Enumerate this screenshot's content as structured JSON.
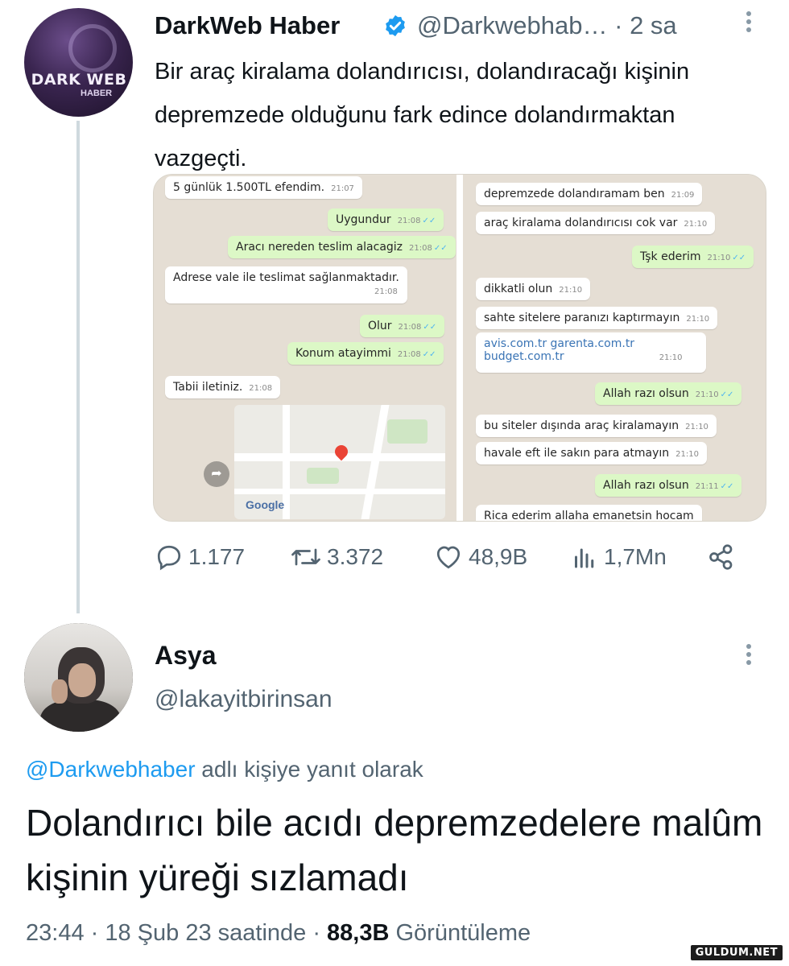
{
  "tweet": {
    "author_name": "DarkWeb Haber",
    "handle": "@Darkwebhab…",
    "time": "· 2 sa",
    "avatar_text": "DARK WEB",
    "avatar_sub": "HABER",
    "text": "Bir araç kiralama dolandırıcısı, dolandıracağı kişinin depremzede olduğunu fark edince dolandırmaktan vazgeçti.",
    "chat_left": [
      {
        "text": "5 günlük 1.500TL efendim.",
        "time": "21:07",
        "dir": "in"
      },
      {
        "text": "Uygundur",
        "time": "21:08",
        "dir": "out"
      },
      {
        "text": "Aracı nereden teslim alacagiz",
        "time": "21:08",
        "dir": "out"
      },
      {
        "text": "Adrese vale ile teslimat sağlanmaktadır.",
        "time": "21:08",
        "dir": "in"
      },
      {
        "text": "Olur",
        "time": "21:08",
        "dir": "out"
      },
      {
        "text": "Konum atayimmi",
        "time": "21:08",
        "dir": "out"
      },
      {
        "text": "Tabii iletiniz.",
        "time": "21:08",
        "dir": "in"
      }
    ],
    "map_label": "Google",
    "chat_right": [
      {
        "text": "depremzede dolandıramam ben",
        "time": "21:09",
        "dir": "in"
      },
      {
        "text": "araç kiralama dolandırıcısı cok var",
        "time": "21:10",
        "dir": "in"
      },
      {
        "text": "Tşk ederim",
        "time": "21:10",
        "dir": "out"
      },
      {
        "text": "dikkatli olun",
        "time": "21:10",
        "dir": "in"
      },
      {
        "text": "sahte sitelere paranızı kaptırmayın",
        "time": "21:10",
        "dir": "in"
      },
      {
        "text": "avis.com.tr garenta.com.tr",
        "text2": "budget.com.tr",
        "time": "21:10",
        "dir": "in"
      },
      {
        "text": "Allah razı olsun",
        "time": "21:10",
        "dir": "out"
      },
      {
        "text": "bu siteler dışında araç kiralamayın",
        "time": "21:10",
        "dir": "in"
      },
      {
        "text": "havale eft ile sakın para atmayın",
        "time": "21:10",
        "dir": "in"
      },
      {
        "text": "Allah razı olsun",
        "time": "21:11",
        "dir": "out"
      },
      {
        "text": "Rica ederim allaha emanetsin hocam",
        "time": "",
        "dir": "in"
      }
    ],
    "stats": {
      "replies": "1.177",
      "retweets": "3.372",
      "likes": "48,9B",
      "views": "1,7Mn"
    }
  },
  "reply": {
    "author_name": "Asya",
    "handle": "@lakayitbirinsan",
    "reply_to_mention": "@Darkwebhaber",
    "reply_to_suffix": " adlı kişiye yanıt olarak",
    "text": "Dolandırıcı bile acıdı depremzedelere malûm kişinin yüreği sızlamadı",
    "time": "23:44 · 18 Şub 23 saatinde · ",
    "views_count": "88,3B",
    "views_label": " Görüntüleme"
  },
  "watermark": "GULDUM.NET",
  "colors": {
    "accent": "#1d9bf0",
    "muted": "#536471",
    "chat_out": "#dcf8c6",
    "chat_bg": "#e5ded4"
  }
}
